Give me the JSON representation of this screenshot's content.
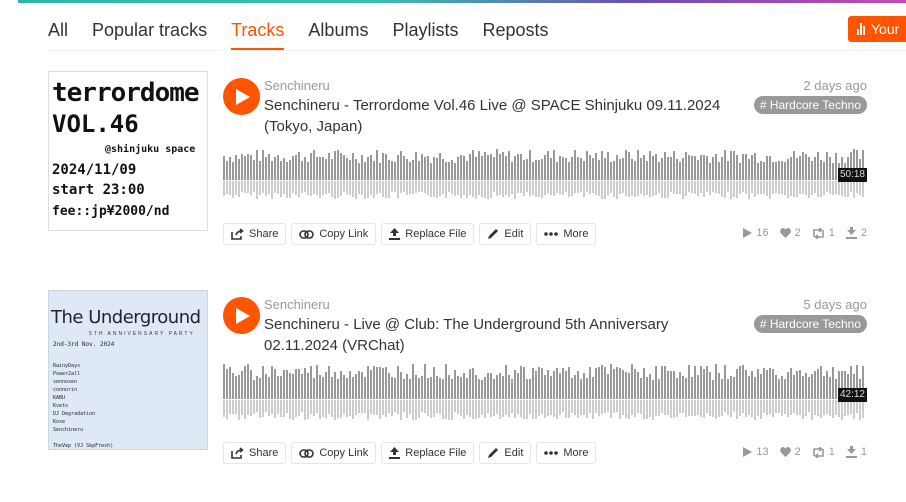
{
  "nav": {
    "tabs": [
      {
        "label": "All",
        "active": false
      },
      {
        "label": "Popular tracks",
        "active": false
      },
      {
        "label": "Tracks",
        "active": true
      },
      {
        "label": "Albums",
        "active": false
      },
      {
        "label": "Playlists",
        "active": false
      },
      {
        "label": "Reposts",
        "active": false
      }
    ],
    "insights_button": "Your"
  },
  "colors": {
    "accent": "#ff5500",
    "tag_bg": "#999999",
    "waveform": "#999999"
  },
  "actions": {
    "share": "Share",
    "copy_link": "Copy Link",
    "replace_file": "Replace File",
    "edit": "Edit",
    "more": "More"
  },
  "tracks": [
    {
      "uploader": "Senchineru",
      "title": "Senchineru - Terrordome Vol.46 Live @ SPACE Shinjuku 09.11.2024 (Tokyo, Japan)",
      "posted": "2 days ago",
      "tag": "# Hardcore Techno",
      "duration": "50:18",
      "plays": "16",
      "likes": "2",
      "reposts": "1",
      "downloads": "2",
      "artwork": {
        "lines": [
          "terrordome",
          "VOL.46",
          "@shinjuku space",
          "2024/11/09",
          "start 23:00",
          "fee::jp¥2000/nd"
        ]
      }
    },
    {
      "uploader": "Senchineru",
      "title": "Senchineru - Live @ Club: The Underground 5th Anniversary 02.11.2024 (VRChat)",
      "posted": "5 days ago",
      "tag": "# Hardcore Techno",
      "duration": "42:12",
      "plays": "13",
      "likes": "2",
      "reposts": "1",
      "downloads": "1",
      "artwork": {
        "title": "The Underground",
        "subtitle": "5TH ANNIVERSARY PARTY",
        "lines": [
          "2nd-3rd Nov. 2024",
          "RainyDays",
          "Power2all",
          "sennosen",
          "connorin",
          "KABU",
          "Kveto",
          "DJ Degradation",
          "Kose",
          "Senchineru",
          "TheVep (VJ SkpFresh)"
        ]
      }
    }
  ]
}
